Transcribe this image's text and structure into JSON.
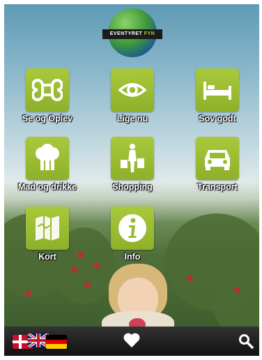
{
  "app": {
    "logo_text_main": "EVENTYRET",
    "logo_text_accent": "FYN"
  },
  "menu": [
    {
      "label": "Se og Oplev",
      "icon": "command-icon"
    },
    {
      "label": "Lige nu",
      "icon": "eye-icon"
    },
    {
      "label": "Sov godt",
      "icon": "bed-icon"
    },
    {
      "label": "Mad og drikke",
      "icon": "chef-hat-icon"
    },
    {
      "label": "Shopping",
      "icon": "shopper-icon"
    },
    {
      "label": "Transport",
      "icon": "car-icon"
    },
    {
      "label": "Kort",
      "icon": "map-icon"
    },
    {
      "label": "Info",
      "icon": "info-icon"
    }
  ],
  "bottom_bar": {
    "languages": [
      "danish-flag-icon",
      "british-flag-icon",
      "german-flag-icon"
    ],
    "favorites_icon": "heart-icon",
    "search_icon": "search-icon"
  },
  "colors": {
    "tile_green": "#9abb30",
    "bar_dark": "#1a1a1a",
    "label_white": "#ffffff"
  }
}
